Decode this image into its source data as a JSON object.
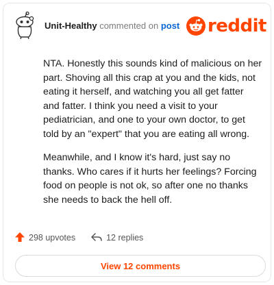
{
  "comment": {
    "username": "Unit-Healthy",
    "action_text": "commented on",
    "post_link": "post",
    "paragraphs": [
      "NTA. Honestly this sounds kind of malicious on her part. Shoving all this crap at you and the kids, not eating it herself, and watching you all get fatter and fatter. I think you need a visit to your pediatrician, and one to your own doctor, to get told by an \"expert\" that you are eating all wrong.",
      "Meanwhile, and I know it's hard, just say no thanks. Who cares if it hurts her feelings? Forcing food on people is not ok, so after one no thanks she needs to back the hell off."
    ]
  },
  "brand": {
    "name": "reddit",
    "icon": "reddit-snoo-icon",
    "color": "#ff4500"
  },
  "actions": {
    "upvotes": "298 upvotes",
    "upvote_icon": "upvote-arrow-icon",
    "upvote_color": "#ff4500",
    "replies": "12 replies",
    "reply_icon": "reply-arrow-icon"
  },
  "view_button": {
    "label": "View 12 comments"
  },
  "avatar": {
    "icon": "snoo-avatar-icon"
  }
}
